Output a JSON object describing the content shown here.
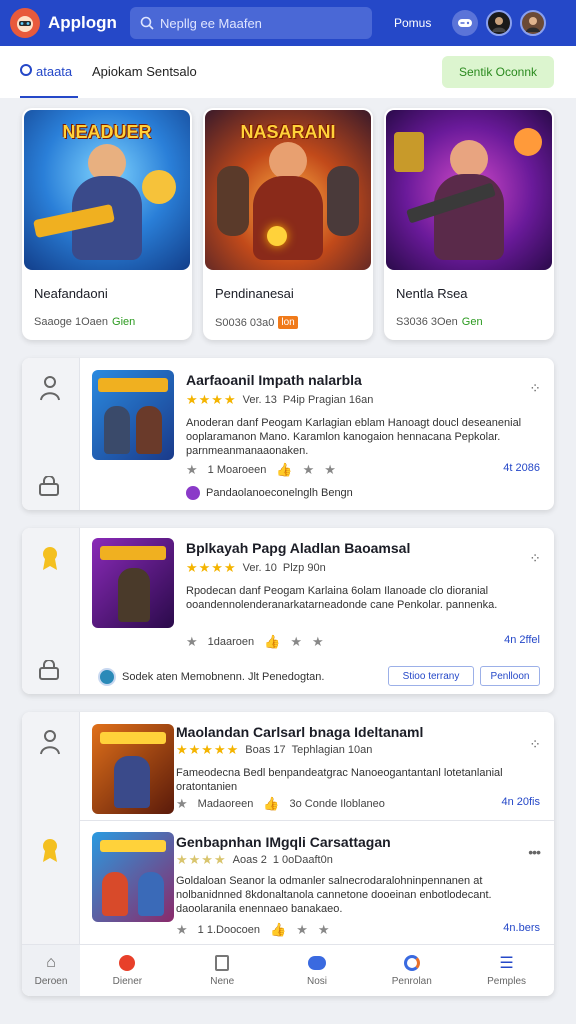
{
  "header": {
    "app_title": "Applogn",
    "search_placeholder": "Nepllg ee Maafen",
    "link": "Pomus"
  },
  "subbar": {
    "tabs": [
      {
        "label": "ataata"
      },
      {
        "label": "Apiokam Sentsalo"
      }
    ],
    "action_label": "Sentik Oconnk"
  },
  "cards": [
    {
      "art_title": "NEADUER",
      "name": "Neafandaoni",
      "meta": "Saaoge 1Oaen",
      "tag": "Gien"
    },
    {
      "art_title": "NASARANI",
      "name": "Pendinanesai",
      "meta": "S0036 03a0",
      "tag": "lon"
    },
    {
      "art_title": "",
      "name": "Nentla Rsea",
      "meta": "S3036 3Oen",
      "tag": "Gen"
    }
  ],
  "items": [
    {
      "title": "Aarfaoanil Impath nalarbla",
      "version": "Ver. 13",
      "publisher": "P4ip Pragian 16an",
      "desc": "Anoderan danf Peogam Karlagian eblam Hanoagt doucl deseanenial ooplaramanon Mano. Karamlon kanogaion hennacana Pepkolar. parnmeanmanaaonaken.",
      "actions": [
        "1 Moaroeen"
      ],
      "price": "4t 2086",
      "footer": "Pandaolanoeconelnglh Bengn"
    },
    {
      "title": "Bplkayah Papg Aladlan Baoamsal",
      "version": "Ver. 10",
      "publisher": "Plzp 90n",
      "desc": "Rpodecan danf Peogam Karlaina 6olam Ilanoade clo dioranial ooandennolenderanarkatarneadonde cane Penkolar. pannenka.",
      "actions": [
        "1daaroen"
      ],
      "price": "4n 2ffel",
      "footer": "Sodek aten Memobnenn. Jlt Penedogtan.",
      "btn1": "Stioo terrany",
      "btn2": "Penlloon"
    },
    {
      "title": "Maolandan Carlsarl bnaga Ideltanaml",
      "version": "Boas 17",
      "publisher": "Tephlagian 10an",
      "desc": "Fameodecna Bedl benpandeatgrac Nanoeogantantanl lotetanlanial oratontanien",
      "actions": [
        "Madaoreen",
        "3o Conde Iloblaneo"
      ],
      "price": "4n 20fis"
    },
    {
      "title": "Genbapnhan IMgqli Carsattagan",
      "version": "Aoas 2",
      "publisher": "1 0oDaaft0n",
      "desc": "Goldaloan Seanor la odmanler salnecrodaralohninpennanen at nolbanidnned 8kdonaltanola cannetone dooeinan enbotlodecant. daoolaranila enennaeo banakaeo.",
      "actions": [
        "1 1.Doocoen"
      ],
      "price": "4n.bers"
    }
  ],
  "bottom_nav": [
    {
      "label": "Deroen",
      "icon": "home-icon"
    },
    {
      "label": "Diener",
      "icon": "game-icon"
    },
    {
      "label": "Nene",
      "icon": "doc-icon"
    },
    {
      "label": "Nosi",
      "icon": "chat-icon"
    },
    {
      "label": "Penrolan",
      "icon": "chat-bubble-icon"
    },
    {
      "label": "Pemples",
      "icon": "menu-icon"
    }
  ],
  "colors": {
    "primary": "#2548c8",
    "accent_green": "#2b8a1f",
    "star": "#f4b400"
  }
}
